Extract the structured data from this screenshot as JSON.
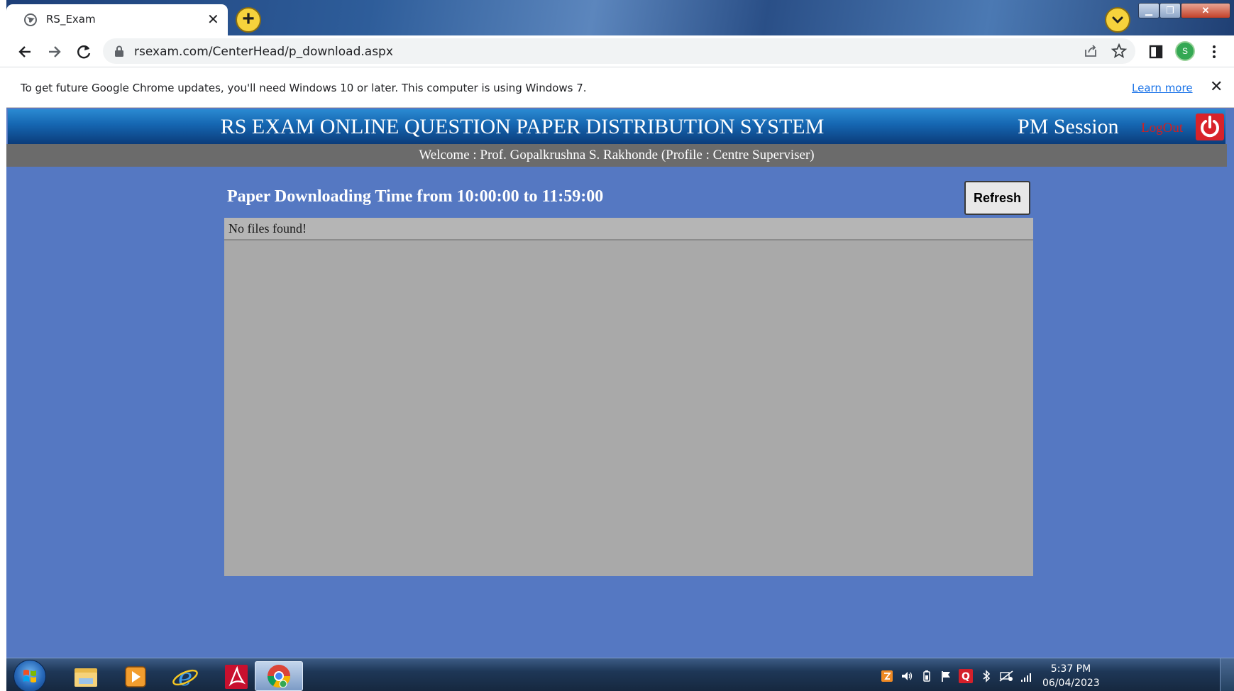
{
  "browser": {
    "tab": {
      "title": "RS_Exam"
    },
    "address": {
      "url": "rsexam.com/CenterHead/p_download.aspx"
    },
    "profile": {
      "initial": "S"
    },
    "infobar": {
      "message": "To get future Google Chrome updates, you'll need Windows 10 or later. This computer is using Windows 7.",
      "link": "Learn more"
    },
    "colors": {
      "new_tab_button": "#f6d23c",
      "profile_avatar": "#34a853"
    },
    "icons": [
      "globe-icon",
      "close-icon",
      "plus-icon",
      "chevron-down-icon",
      "back-icon",
      "forward-icon",
      "reload-icon",
      "lock-icon",
      "share-icon",
      "star-icon",
      "side-panel-icon",
      "more-vert-icon"
    ]
  },
  "page": {
    "header": {
      "title": "RS EXAM ONLINE QUESTION PAPER DISTRIBUTION SYSTEM",
      "session": "PM Session",
      "logout": "LogOut"
    },
    "welcome": "Welcome : Prof. Gopalkrushna S. Rakhonde (Profile : Centre Superviser)",
    "download": {
      "heading": "Paper Downloading Time from 10:00:00 to 11:59:00",
      "refresh_label": "Refresh",
      "empty_message": "No files found!"
    },
    "colors": {
      "background": "#5578c2",
      "header": "#1565b0",
      "welcome_bar": "#6b6b6b",
      "panel": "#a9a9a9",
      "logout": "#d41f1f",
      "power_button": "#d8232a"
    }
  },
  "taskbar": {
    "apps": [
      "windows-explorer-icon",
      "media-player-icon",
      "internet-explorer-icon",
      "acrobat-reader-icon",
      "chrome-icon"
    ],
    "tray_icons": [
      "shield-icon",
      "volume-icon",
      "battery-icon",
      "flag-icon",
      "q-icon",
      "bluetooth-icon",
      "network-icon",
      "signal-icon"
    ],
    "clock": {
      "time": "5:37 PM",
      "date": "06/04/2023"
    }
  }
}
